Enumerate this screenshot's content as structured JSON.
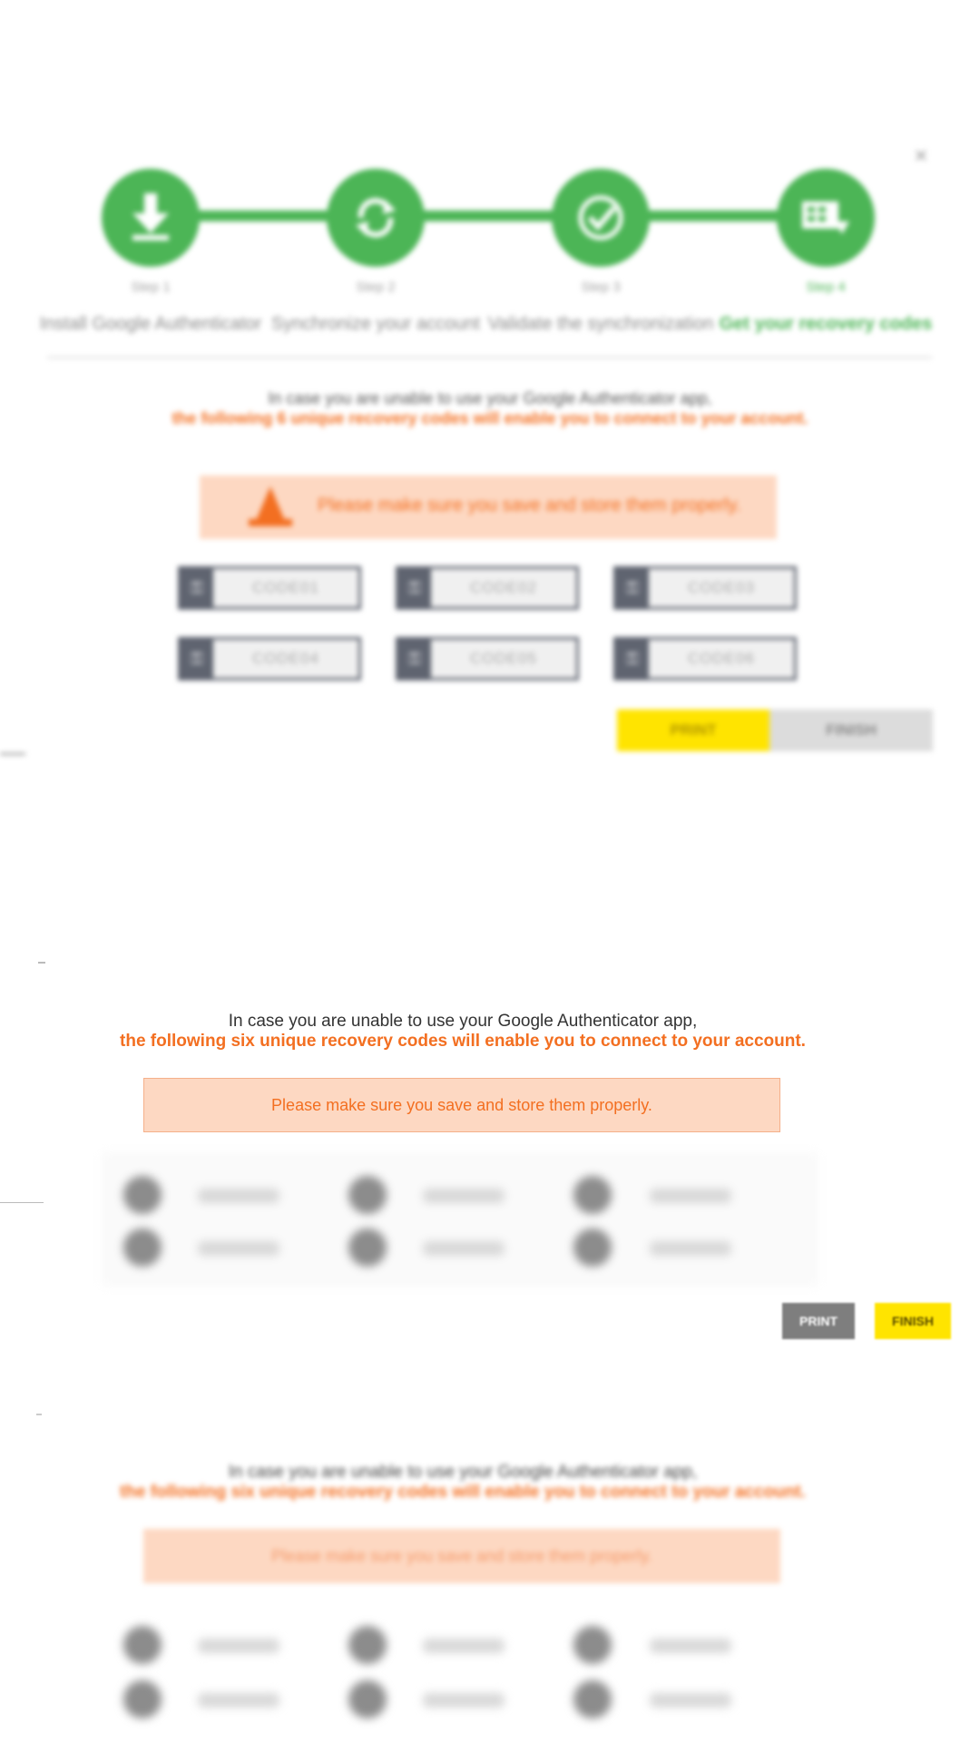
{
  "wizard": {
    "close_label": "×",
    "steps": [
      {
        "num": "Step 1",
        "label": "Install Google Authenticator",
        "icon": "download-icon"
      },
      {
        "num": "Step 2",
        "label": "Synchronize your account",
        "icon": "sync-icon"
      },
      {
        "num": "Step 3",
        "label": "Validate the synchronization",
        "icon": "check-icon"
      },
      {
        "num": "Step 4",
        "label": "Get your recovery codes",
        "icon": "codes-icon"
      }
    ],
    "intro_line1": "In case you are unable to use your Google Authenticator app,",
    "intro_line2": "the following 6 unique recovery codes will enable you to connect to your account.",
    "warning": "Please make sure you save and store them properly.",
    "codes": [
      "CODE01",
      "CODE02",
      "CODE03",
      "CODE04",
      "CODE05",
      "CODE06"
    ],
    "print_label": "PRINT",
    "finish_label": "FINISH",
    "accent_color": "#4cb556",
    "warn_color": "#f36f21"
  },
  "panel": {
    "intro_line1": "In case you are unable to use your Google Authenticator app,",
    "intro_line2": "the following six unique recovery codes will enable you to connect to your account.",
    "warning": "Please make sure you save and store them properly.",
    "print_label": "PRINT",
    "finish_label": "FINISH",
    "print_color": "#7e7e7e",
    "finish_color": "#ffe400"
  },
  "panel_repeat": {
    "intro_line1": "In case you are unable to use your Google Authenticator app,",
    "intro_line2": "the following six unique recovery codes will enable you to connect to your account.",
    "warning": "Please make sure you save and store them properly."
  }
}
